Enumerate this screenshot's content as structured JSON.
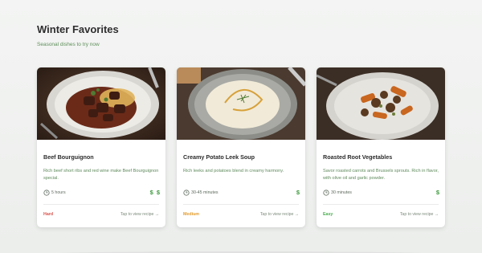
{
  "header": {
    "title": "Winter Favorites",
    "subtitle": "Seasonal dishes to try now"
  },
  "colors": {
    "accent_green": "#5f8f5a",
    "cost_green": "#3e9a3e",
    "hard": "#d9534f",
    "medium": "#e39b2c",
    "easy": "#4caf50"
  },
  "cards": [
    {
      "title": "Beef Bourguignon",
      "description": "Rich beef short ribs and red wine make Beef Bourguignon special.",
      "time": "5 hours",
      "cost": "$ $",
      "difficulty": "Hard",
      "link": "Tap to view recipe →",
      "image_icon": "beef-stew-photo"
    },
    {
      "title": "Creamy Potato Leek Soup",
      "description": "Rich leeks and potatoes blend in creamy harmony.",
      "time": "30-45 minutes",
      "cost": "$",
      "difficulty": "Medium",
      "link": "Tap to view recipe →",
      "image_icon": "soup-bowl-photo"
    },
    {
      "title": "Roasted Root Vegetables",
      "description": "Savor roasted carrots and Brussels sprouts. Rich in flavor, with olive oil and garlic powder.",
      "time": "30 minutes",
      "cost": "$",
      "difficulty": "Easy",
      "link": "Tap to view recipe →",
      "image_icon": "roasted-vegetables-photo"
    }
  ]
}
